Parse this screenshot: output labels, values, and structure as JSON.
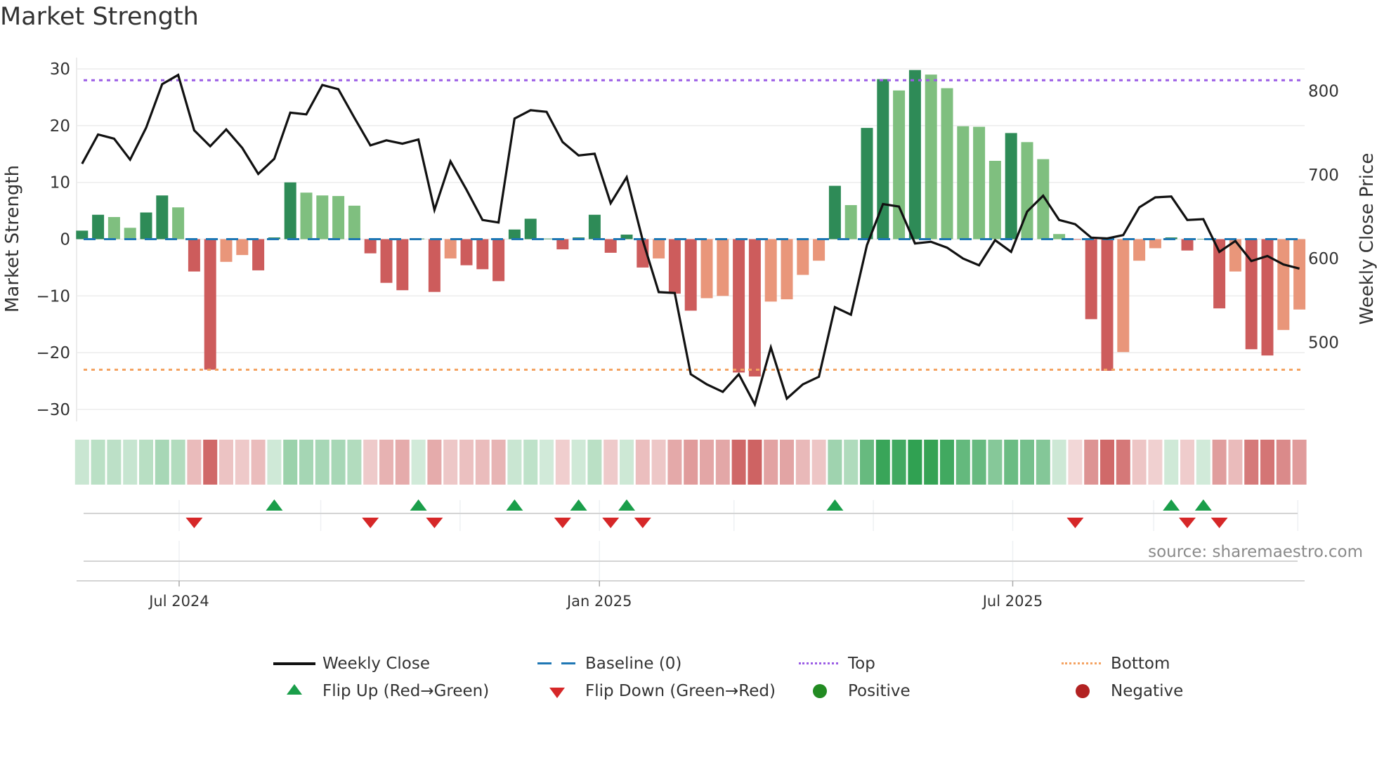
{
  "title": "Market Strength",
  "source": "source: sharemaestro.com",
  "legend": {
    "weekly_close": "Weekly Close",
    "baseline": "Baseline (0)",
    "top": "Top",
    "bottom": "Bottom",
    "flip_up": "Flip Up (Red→Green)",
    "flip_down": "Flip Down (Green→Red)",
    "positive": "Positive",
    "negative": "Negative"
  },
  "colors": {
    "dark_green": "#2e8b57",
    "light_green": "#7fbf7f",
    "dark_red": "#cd5c5c",
    "light_red": "#e9967a",
    "baseline": "#1f77b4",
    "top": "#9b5de5",
    "bottom": "#f4a261",
    "flip_up": "#1a9e4a",
    "flip_down": "#d62728",
    "positive": "#228b22",
    "negative": "#b22222",
    "line": "#111111"
  },
  "chart_data": {
    "type": "bar",
    "title": "Market Strength",
    "ylabel": "Market Strength",
    "y2label": "Weekly Close Price",
    "ylim": [
      -32,
      32
    ],
    "y2lim": [
      411,
      823
    ],
    "yticks": [
      30,
      20,
      10,
      0,
      -10,
      -20,
      -30
    ],
    "yticklabels": [
      "30",
      "20",
      "10",
      "0",
      "−10",
      "−20",
      "−30"
    ],
    "y2ticks": [
      800,
      700,
      600,
      500
    ],
    "y2ticklabels": [
      "800",
      "700",
      "600",
      "500"
    ],
    "top_level": 28,
    "bottom_level": -23,
    "baseline": 0,
    "xticks": [
      {
        "label": "Jul 2024",
        "week": 6.06
      },
      {
        "label": "Jan 2025",
        "week": 32.3
      },
      {
        "label": "Jul 2025",
        "week": 58.1
      }
    ],
    "minor_xticks": [
      14.9,
      23.6,
      40.7,
      49.4,
      66.9,
      75.9
    ],
    "strength": [
      1.5,
      4.3,
      3.9,
      2.0,
      4.7,
      7.7,
      5.6,
      -5.7,
      -23.0,
      -4.0,
      -2.8,
      -5.5,
      0.3,
      10.0,
      8.2,
      7.7,
      7.6,
      5.9,
      -2.5,
      -7.7,
      -9.0,
      0.1,
      -9.3,
      -3.4,
      -4.6,
      -5.3,
      -7.4,
      1.7,
      3.6,
      0.1,
      -1.8,
      0.3,
      4.3,
      -2.4,
      0.8,
      -5.0,
      -3.4,
      -9.6,
      -12.6,
      -10.4,
      -10.0,
      -23.5,
      -24.2,
      -11.0,
      -10.6,
      -6.3,
      -3.8,
      9.4,
      6.0,
      19.6,
      28.2,
      26.2,
      29.8,
      29.0,
      26.6,
      19.9,
      19.8,
      13.8,
      18.7,
      17.1,
      14.1,
      0.9,
      -0.1,
      -14.1,
      -23.2,
      -19.9,
      -3.8,
      -1.6,
      0.3,
      -2.0,
      0.05,
      -12.2,
      -5.7,
      -19.4,
      -20.5,
      -16.0,
      -12.4
    ],
    "shade": [
      "D",
      "D",
      "L",
      "L",
      "D",
      "D",
      "L",
      "D",
      "D",
      "L",
      "L",
      "D",
      "D",
      "D",
      "L",
      "L",
      "L",
      "L",
      "D",
      "D",
      "D",
      "D",
      "D",
      "L",
      "D",
      "D",
      "D",
      "D",
      "D",
      "D",
      "D",
      "D",
      "D",
      "D",
      "D",
      "D",
      "L",
      "D",
      "D",
      "L",
      "L",
      "D",
      "D",
      "L",
      "L",
      "L",
      "L",
      "D",
      "L",
      "D",
      "D",
      "L",
      "D",
      "L",
      "L",
      "L",
      "L",
      "L",
      "D",
      "L",
      "L",
      "L",
      "D",
      "D",
      "D",
      "L",
      "L",
      "L",
      "D",
      "D",
      "D",
      "D",
      "L",
      "D",
      "D",
      "L",
      "L"
    ],
    "weekly_close": [
      713,
      748,
      743,
      718,
      756,
      808,
      819,
      753,
      734,
      754,
      732,
      701,
      719,
      774,
      772,
      807,
      802,
      768,
      735,
      741,
      737,
      742,
      658,
      716,
      682,
      646,
      643,
      767,
      777,
      775,
      739,
      723,
      725,
      666,
      697,
      622,
      560,
      559,
      462,
      450,
      441,
      462,
      426,
      494,
      433,
      450,
      459,
      542,
      533,
      616,
      665,
      662,
      618,
      620,
      613,
      600,
      592,
      622,
      608,
      656,
      675,
      646,
      641,
      625,
      624,
      628,
      661,
      673,
      674,
      646,
      647,
      608,
      621,
      597,
      603,
      593,
      588
    ],
    "flip_up_weeks": [
      12,
      21,
      27,
      31,
      34,
      47,
      68,
      70
    ],
    "flip_down_weeks": [
      7,
      18,
      22,
      30,
      33,
      35,
      62,
      69,
      71
    ]
  }
}
